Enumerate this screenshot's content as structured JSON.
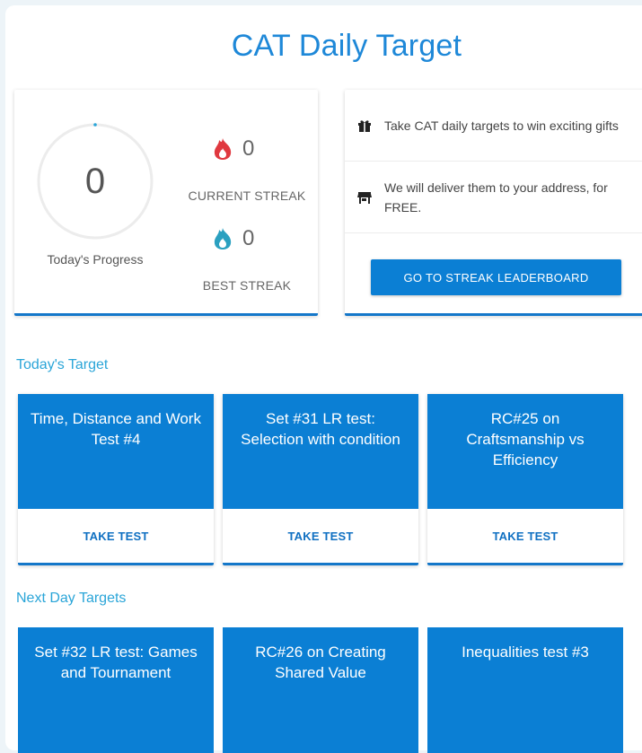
{
  "page": {
    "title": "CAT Daily Target"
  },
  "progress": {
    "value": "0",
    "label": "Today's Progress",
    "current_streak": {
      "value": "0",
      "label": "CURRENT STREAK",
      "color": "#e0383f"
    },
    "best_streak": {
      "value": "0",
      "label": "BEST STREAK",
      "color": "#2aa0c0"
    }
  },
  "gifts": {
    "rows": [
      {
        "icon": "gift-icon",
        "text": "Take CAT daily targets to win exciting gifts"
      },
      {
        "icon": "store-icon",
        "text": "We will deliver them to your address, for FREE."
      }
    ],
    "button_label": "GO TO STREAK LEADERBOARD"
  },
  "today": {
    "title": "Today's Target",
    "targets": [
      {
        "name": "Time, Distance and Work Test #4",
        "action": "TAKE TEST"
      },
      {
        "name": "Set #31 LR test: Selection with condition",
        "action": "TAKE TEST"
      },
      {
        "name": "RC#25 on Craftsmanship vs Efficiency",
        "action": "TAKE TEST"
      }
    ]
  },
  "next": {
    "title": "Next Day Targets",
    "targets": [
      {
        "name": "Set #32 LR test: Games and Tournament"
      },
      {
        "name": "RC#26 on Creating Shared Value"
      },
      {
        "name": "Inequalities test #3"
      }
    ]
  },
  "colors": {
    "accent": "#0b7fd4",
    "title": "#1e88d8",
    "section": "#2aa5d8"
  }
}
